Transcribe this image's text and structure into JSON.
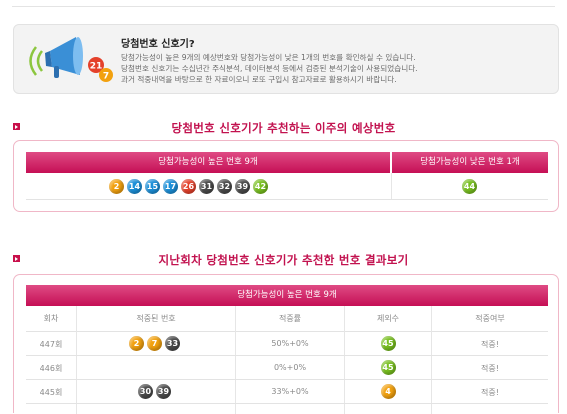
{
  "info": {
    "title": "당첨번호 신호기?",
    "lines": [
      "당첨가능성이 높은 9개의 예상번호와 당첨가능성이 낮은 1개의 번호를 확인하실 수 있습니다.",
      "당첨번호 신호기는 수십년간 주식분석, 데이터분석 등에서 검증된 분석기술이 사용되었습니다.",
      "과거 적중내역을 바탕으로 한 자료이오니 로또 구입시 참고자료로 활용하시기 바랍니다."
    ],
    "art_numbers": [
      "21",
      "7"
    ]
  },
  "section1": {
    "heading": "당첨번호 신호기가 추천하는 이주의 예상번호",
    "col_high": "당첨가능성이 높은 번호 9개",
    "col_low": "당첨가능성이 낮은 번호 1개",
    "high_numbers": [
      {
        "n": "2",
        "color": "#f2a10f"
      },
      {
        "n": "14",
        "color": "#1b8fd8"
      },
      {
        "n": "15",
        "color": "#1b8fd8"
      },
      {
        "n": "17",
        "color": "#1b8fd8"
      },
      {
        "n": "26",
        "color": "#e4412b"
      },
      {
        "n": "31",
        "color": "#4a4a4a"
      },
      {
        "n": "32",
        "color": "#4a4a4a"
      },
      {
        "n": "39",
        "color": "#4a4a4a"
      },
      {
        "n": "42",
        "color": "#78bf1f"
      }
    ],
    "low_number": {
      "n": "44",
      "color": "#78bf1f"
    }
  },
  "section2": {
    "heading": "지난회차 당첨번호 신호기가 추천한 번호 결과보기",
    "group_header": "당첨가능성이 높은 번호 9개",
    "columns": [
      "회차",
      "적중된 번호",
      "적중률",
      "제외수",
      "적중여부"
    ],
    "rows": [
      {
        "round": "447회",
        "hits": [
          {
            "n": "2",
            "color": "#f2a10f"
          },
          {
            "n": "7",
            "color": "#f2a10f"
          },
          {
            "n": "33",
            "color": "#4a4a4a"
          }
        ],
        "rate": "50%+0%",
        "excluded": {
          "n": "45",
          "color": "#78bf1f"
        },
        "result": "적중!"
      },
      {
        "round": "446회",
        "hits": [],
        "rate": "0%+0%",
        "excluded": {
          "n": "45",
          "color": "#78bf1f"
        },
        "result": "적중!"
      },
      {
        "round": "445회",
        "hits": [
          {
            "n": "30",
            "color": "#4a4a4a"
          },
          {
            "n": "39",
            "color": "#4a4a4a"
          }
        ],
        "rate": "33%+0%",
        "excluded": {
          "n": "4",
          "color": "#f2a10f"
        },
        "result": "적중!"
      }
    ]
  }
}
